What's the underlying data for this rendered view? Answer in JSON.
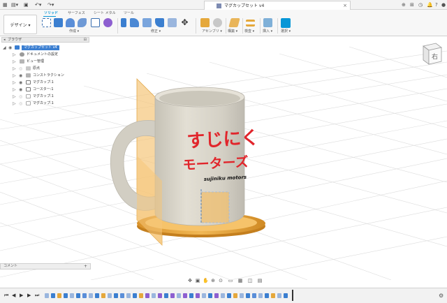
{
  "titlebar": {
    "tab_title": "マグカップセット v4",
    "tab_close": "×"
  },
  "ribbon": {
    "design_button": "デザイン ▾",
    "tabs": [
      "ソリッド",
      "サーフェス",
      "シート メタル",
      "ツール"
    ],
    "groups": [
      "作成 ▾",
      "修正 ▾",
      "アセンブリ ▾",
      "構築 ▾",
      "検査 ▾",
      "挿入 ▾",
      "選択 ▾"
    ]
  },
  "browser": {
    "header": "ブラウザ",
    "root": "マグカップセット v4",
    "items": [
      "ドキュメントの設定",
      "ビュー管理",
      "原点",
      "コンストラクション",
      "マグカップ:1",
      "コースター:1",
      "マグカップ:1",
      "マグカップ:1"
    ]
  },
  "viewcube": {
    "face_label": "右"
  },
  "mug_print": {
    "line1": "すじにく",
    "line2": "モーターズ",
    "line3": "sujiniku motors"
  },
  "comments": {
    "label": "コメント",
    "add": "+"
  },
  "colors": {
    "accent": "#0696d7",
    "mug": "#d8d4c9",
    "coaster": "#e7a838",
    "plane": "#f5c67a",
    "print_red": "#e1252b"
  }
}
